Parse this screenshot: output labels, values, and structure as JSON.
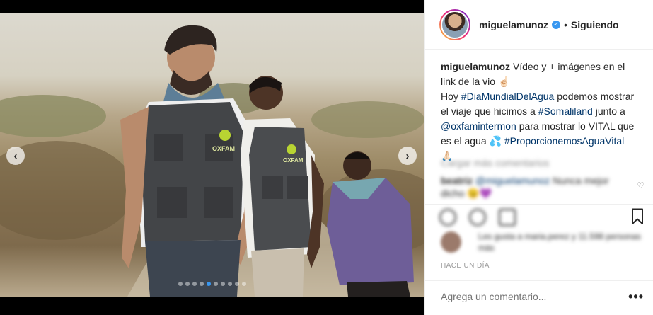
{
  "media": {
    "slide_count": 10,
    "active_slide": 5,
    "vest_text": "OXFAM"
  },
  "profile": {
    "username": "miguelamunoz",
    "verified_symbol": "✓",
    "separator": "•",
    "follow_status": "Siguiendo"
  },
  "caption": {
    "user": "miguelamunoz",
    "line1": "Vídeo y + imágenes en el link de la vio",
    "emoji_point": "☝🏻",
    "text_a": "Hoy ",
    "tag1": "#DiaMundialDelAgua",
    "text_b": " podemos mostrar el viaje que hicimos a ",
    "tag2": "#Somaliland",
    "text_c": " junto a ",
    "mention": "@oxfamintermon",
    "text_d": " para mostrar lo VITAL que es el agua ",
    "emoji_water": "💦",
    "tag3": "#ProporcionemosAguaVital",
    "emoji_pray": "🙏🏻"
  },
  "comments": {
    "view_all": "Cargar más comentarios",
    "comment_user": "beatriz",
    "comment_mention": "@miguelamunoz",
    "comment_text": "Nunca mejor dicho 😉💜",
    "like_icon": "♡"
  },
  "likes": {
    "text": "Les gusta a maria.perez y 11.598 personas más"
  },
  "time_label": "HACE UN DÍA",
  "comment_box": {
    "placeholder": "Agrega un comentario...",
    "more": "•••"
  },
  "colors": {
    "accent": "#3897f0",
    "link": "#003569",
    "text": "#262626",
    "muted": "#999999"
  }
}
